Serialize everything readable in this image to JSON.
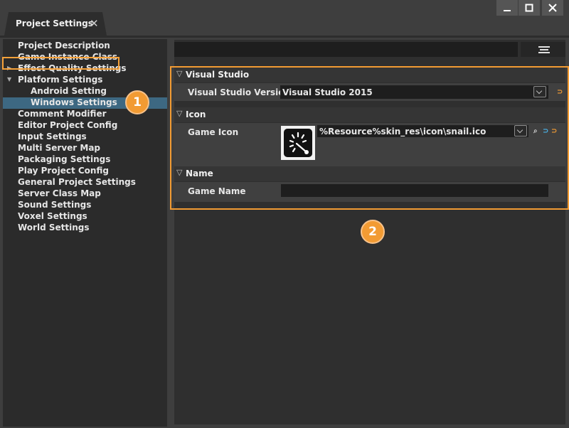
{
  "window": {
    "tab_title": "Project Settings",
    "tab_close": "✕",
    "minimize": "—",
    "maximize": "☐",
    "close": "✕"
  },
  "tree": [
    {
      "label": "Project Description",
      "indent": 0
    },
    {
      "label": "Game Instance Class",
      "indent": 0
    },
    {
      "label": "Effect Quality Settings",
      "indent": 0,
      "arrow": "▶"
    },
    {
      "label": "Platform Settings",
      "indent": 0,
      "arrow": "▼"
    },
    {
      "label": "Android Setting",
      "indent": 1
    },
    {
      "label": "Windows Settings",
      "indent": 1,
      "selected": true
    },
    {
      "label": "Comment Modifier",
      "indent": 0
    },
    {
      "label": "Editor Project Config",
      "indent": 0
    },
    {
      "label": "Input Settings",
      "indent": 0
    },
    {
      "label": "Multi Server Map",
      "indent": 0
    },
    {
      "label": "Packaging Settings",
      "indent": 0
    },
    {
      "label": "Play Project Config",
      "indent": 0
    },
    {
      "label": "General Project Settings",
      "indent": 0
    },
    {
      "label": "Server Class Map",
      "indent": 0
    },
    {
      "label": "Sound Settings",
      "indent": 0
    },
    {
      "label": "Voxel Settings",
      "indent": 0
    },
    {
      "label": "World Settings",
      "indent": 0
    }
  ],
  "badges": {
    "one": "1",
    "two": "2"
  },
  "sections": {
    "visual_studio": {
      "title": "Visual Studio",
      "arrow": "▽",
      "version_label": "Visual Studio Version",
      "version_value": "Visual Studio 2015",
      "reset_icon": "⊃"
    },
    "icon": {
      "title": "Icon",
      "arrow": "▽",
      "game_icon_label": "Game Icon",
      "path_value": "%Resource%skin_res\\icon\\snail.ico",
      "search_icon": "⌕",
      "use_icon": "⊃",
      "reset_icon": "⊃"
    },
    "name": {
      "title": "Name",
      "arrow": "▽",
      "game_name_label": "Game Name",
      "game_name_value": ""
    }
  },
  "colors": {
    "accent": "#f29b33",
    "selection": "#3d6882",
    "reset": "#f29b33",
    "link": "#4ab3e8"
  }
}
